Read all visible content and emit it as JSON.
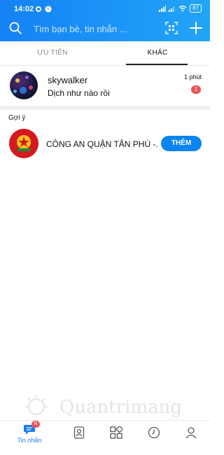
{
  "status_bar": {
    "time": "14:02",
    "battery": "87"
  },
  "search": {
    "placeholder": "Tìm bạn bè, tin nhắn ..."
  },
  "tabs": [
    {
      "label": "ƯU TIÊN"
    },
    {
      "label": "KHÁC"
    }
  ],
  "conversations": [
    {
      "name": "skywalker",
      "message": "Dịch như nào rồi",
      "time": "1 phút",
      "unread": "1"
    }
  ],
  "suggestions": {
    "title": "Gợi ý",
    "items": [
      {
        "name": "CÔNG AN QUẬN TÂN PHÚ -...",
        "button_label": "THÊM"
      }
    ]
  },
  "watermark": {
    "text": "Quantrimang"
  },
  "bottom_nav": {
    "messages": {
      "label": "Tin nhắn",
      "badge": "N"
    },
    "items": [
      "contacts-icon",
      "discover-icon",
      "timeline-icon",
      "profile-icon"
    ]
  },
  "colors": {
    "header_start": "#1481f5",
    "header_end": "#22a5f7",
    "accent": "#1a7df2",
    "badge": "#f05454"
  }
}
